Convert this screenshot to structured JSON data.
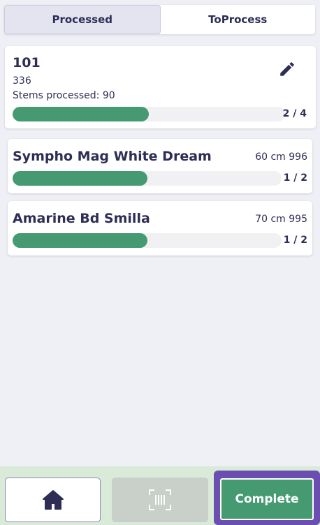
{
  "tabs": [
    {
      "label": "Processed",
      "active": true
    },
    {
      "label": "ToProcess",
      "active": false
    }
  ],
  "summary": {
    "code": "101",
    "sub": "336",
    "stems_processed": "Stems processed:  90",
    "progress_fraction": 0.5,
    "count": "2 / 4",
    "edit_icon": "pencil-icon"
  },
  "items": [
    {
      "name": "Sympho Mag White Dream",
      "meta": "60 cm 996",
      "progress_fraction": 0.5,
      "count": "1 / 2"
    },
    {
      "name": "Amarine Bd Smilla",
      "meta": "70 cm 995",
      "progress_fraction": 0.5,
      "count": "1 / 2"
    }
  ],
  "footer": {
    "home_icon": "home-icon",
    "scan_icon": "barcode-scan-icon",
    "complete_label": "Complete"
  },
  "colors": {
    "accent": "#469a72",
    "text": "#2d2d55",
    "highlight": "#6a4fb0",
    "background": "#eff0f6"
  }
}
